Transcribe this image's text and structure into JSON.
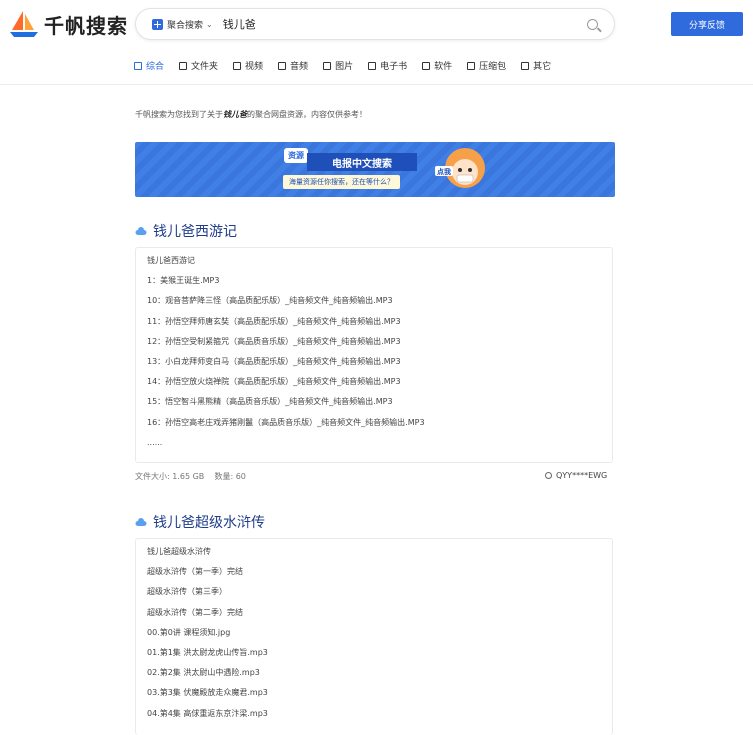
{
  "header": {
    "logo_text": "千帆搜索",
    "search_scope": "聚合搜索",
    "search_query": "钱儿爸",
    "share_button": "分享反馈"
  },
  "tabs": [
    {
      "label": "综合",
      "icon": "home-icon",
      "active": true
    },
    {
      "label": "文件夹",
      "icon": "folder-icon"
    },
    {
      "label": "视频",
      "icon": "video-icon"
    },
    {
      "label": "音频",
      "icon": "audio-icon"
    },
    {
      "label": "图片",
      "icon": "image-icon"
    },
    {
      "label": "电子书",
      "icon": "ebook-icon"
    },
    {
      "label": "软件",
      "icon": "software-icon"
    },
    {
      "label": "压缩包",
      "icon": "archive-icon"
    },
    {
      "label": "其它",
      "icon": "other-icon"
    }
  ],
  "notice": {
    "prefix": "千帆搜索为您找到了关于",
    "keyword": "钱儿爸",
    "suffix": "的聚合网盘资源，内容仅供参考！"
  },
  "banner": {
    "tag": "资源",
    "title": "电报中文搜索",
    "subtitle": "海量资源任你搜索，还在等什么？",
    "badge": "点我"
  },
  "results": [
    {
      "title": "钱儿爸西游记",
      "files": [
        "钱儿爸西游记",
        "1：美猴王诞生.MP3",
        "10：观音菩萨降三怪（高品质配乐版）_纯音频文件_纯音频输出.MP3",
        "11：孙悟空拜师唐玄奘（高品质配乐版）_纯音频文件_纯音频输出.MP3",
        "12：孙悟空受制紧箍咒（高品质音乐版）_纯音频文件_纯音频输出.MP3",
        "13：小白龙拜师变白马（高品质配乐版）_纯音频文件_纯音频输出.MP3",
        "14：孙悟空放火烧禅院（高品质配乐版）_纯音频文件_纯音频输出.MP3",
        "15：悟空智斗黑熊精（高品质音乐版）_纯音频文件_纯音频输出.MP3",
        "16：孙悟空高老庄戏弄猪刚鬣（高品质音乐版）_纯音频文件_纯音频输出.MP3",
        "......"
      ],
      "size_label": "文件大小: 1.65 GB",
      "count_label": "数量: 60",
      "owner": "QYY****EWG"
    },
    {
      "title": "钱儿爸超级水浒传",
      "files": [
        "钱儿爸超级水浒传",
        "超级水浒传（第一季）完结",
        "超级水浒传（第三季）",
        "超级水浒传（第二季）完结",
        "00.第0讲 课程须知.jpg",
        "01.第1集 洪太尉龙虎山传旨.mp3",
        "02.第2集 洪太尉山中遇险.mp3",
        "03.第3集 伏魔殿放走众魔君.mp3",
        "04.第4集 高俅重返东京汴梁.mp3"
      ]
    }
  ],
  "colors": {
    "accent": "#2f6bdc",
    "title": "#1f3d8a"
  }
}
